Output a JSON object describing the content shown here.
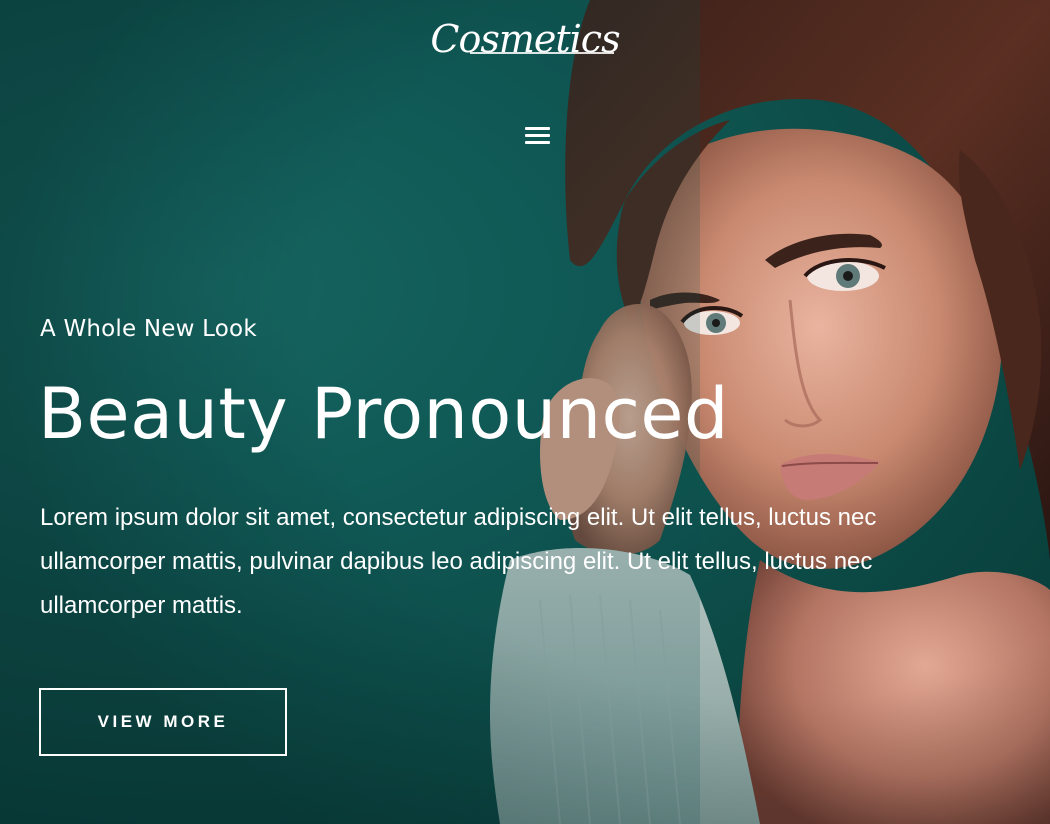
{
  "header": {
    "logo_text": "Cosmetics",
    "menu_icon": "hamburger-menu-icon"
  },
  "hero": {
    "subtitle": "A Whole New Look",
    "title": "Beauty Pronounced",
    "description": "Lorem ipsum dolor sit amet, consectetur adipiscing elit. Ut elit tellus, luctus nec ullamcorper mattis, pulvinar dapibus leo adipiscing elit. Ut elit tellus, luctus nec ullamcorper mattis.",
    "cta_label": "VIEW MORE"
  },
  "colors": {
    "background": "#0d4f4b",
    "text": "#ffffff"
  }
}
